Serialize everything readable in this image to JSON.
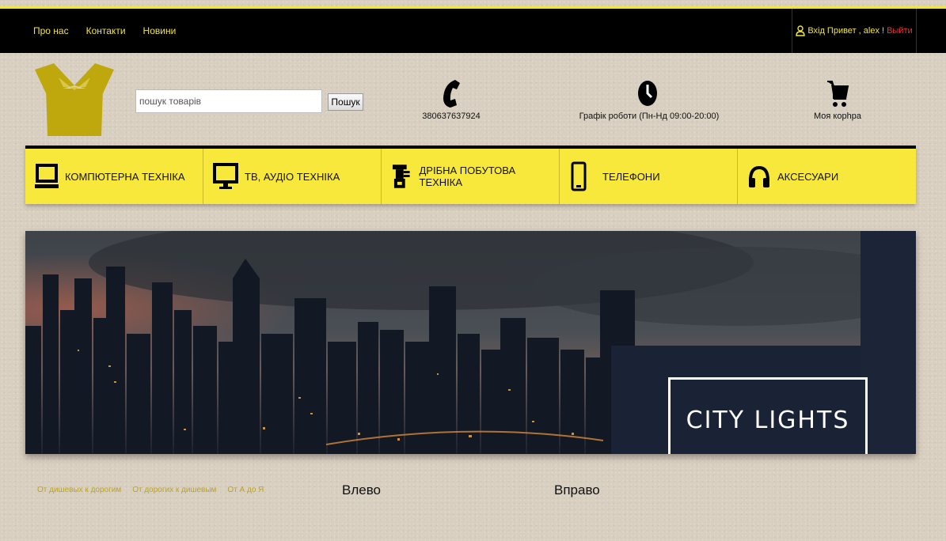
{
  "topbar": {
    "links": [
      "Про нас",
      "Контакти",
      "Новини"
    ],
    "login": "Вхід",
    "greeting": "Привет , alex !",
    "logout": "Выйти"
  },
  "search": {
    "placeholder": "пошук товарів",
    "button": "Пошук"
  },
  "info": {
    "phone": "380637637924",
    "schedule": "Графік роботи (Пн-Нд 09:00-20:00)",
    "cart": "Моя корhpa"
  },
  "categories": [
    {
      "label": "КОМПЮТЕРНА ТЕХНІКА",
      "icon": "laptop-icon"
    },
    {
      "label": "ТВ, АУДІО ТЕХНІКА",
      "icon": "monitor-icon"
    },
    {
      "label": "ДРІБНА ПОБУТОВА ТЕХНІКА",
      "icon": "appliance-icon"
    },
    {
      "label": "ТЕЛЕФОНИ",
      "icon": "phone-icon"
    },
    {
      "label": "АКСЕСУАРИ",
      "icon": "headphones-icon"
    }
  ],
  "banner": {
    "title": "CITY LIGHTS"
  },
  "sort": [
    "От дишевых к дорогим",
    "От дорогих к дишевым",
    "От А до Я"
  ],
  "nav": {
    "left": "Влево",
    "right": "Вправо"
  },
  "colors": {
    "accent": "#f8e83c",
    "logo": "#bfa70e",
    "logout": "#ee3333"
  }
}
